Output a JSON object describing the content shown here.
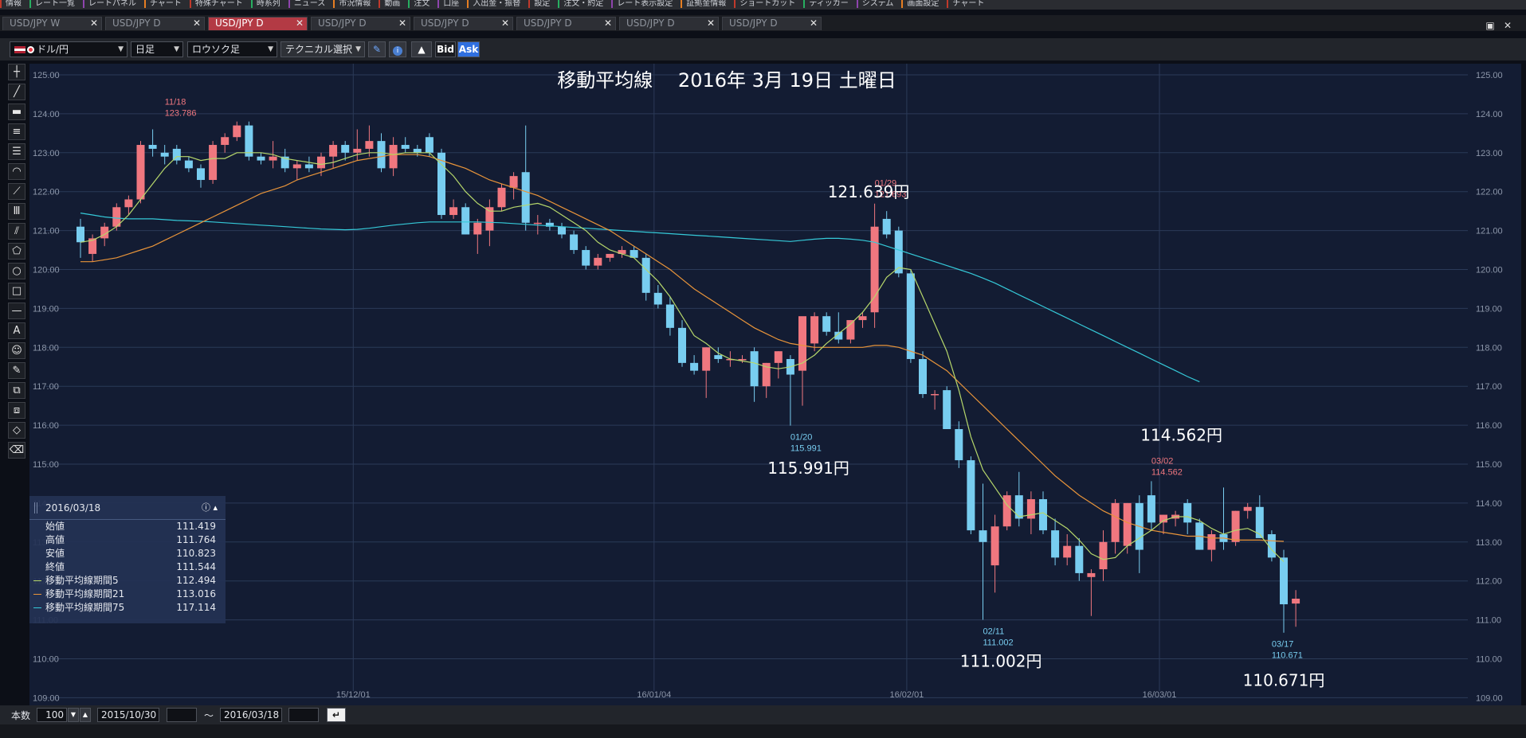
{
  "menubar": [
    "情報",
    "レート一覧",
    "レートパネル",
    "チャート",
    "特殊チャート",
    "時系列",
    "ニュース",
    "市況情報",
    "動画",
    "注文",
    "口座",
    "入出金・振替",
    "設定",
    "注文・約定",
    "レート表示設定",
    "証拠金情報",
    "ショートカット",
    "ティッカー",
    "システム",
    "画面設定",
    "チャート"
  ],
  "tabs": [
    {
      "label": "USD/JPY W",
      "active": false
    },
    {
      "label": "USD/JPY D",
      "active": false
    },
    {
      "label": "USD/JPY D",
      "active": true
    },
    {
      "label": "USD/JPY D",
      "active": false
    },
    {
      "label": "USD/JPY D",
      "active": false
    },
    {
      "label": "USD/JPY D",
      "active": false
    },
    {
      "label": "USD/JPY D",
      "active": false
    },
    {
      "label": "USD/JPY D",
      "active": false
    }
  ],
  "toolbar": {
    "pair": "ドル/円",
    "period": "日足",
    "chart_type": "ロウソク足",
    "technical": "テクニカル選択",
    "bid": "Bid",
    "ask": "Ask"
  },
  "left_tools": [
    "crosshair-icon",
    "line-icon",
    "ruler-icon",
    "horizontal-lines-icon",
    "parallel-lines-icon",
    "arc-icon",
    "fan-icon",
    "grid-lines-icon",
    "trend-channel-icon",
    "pentagon-icon",
    "circle-icon",
    "rectangle-icon",
    "horizontal-line-icon",
    "text-icon",
    "emoji-icon",
    "paint-icon",
    "copy-icon",
    "layer-icon",
    "eraser-icon",
    "clear-icon"
  ],
  "left_tool_text": {
    "text": "A"
  },
  "info": {
    "date": "2016/03/18",
    "rows": [
      {
        "label": "始値",
        "value": "111.419",
        "color": ""
      },
      {
        "label": "高値",
        "value": "111.764",
        "color": ""
      },
      {
        "label": "安値",
        "value": "110.823",
        "color": ""
      },
      {
        "label": "終値",
        "value": "111.544",
        "color": ""
      },
      {
        "label": "移動平均線期間5",
        "value": "112.494",
        "color": "#b6d76b"
      },
      {
        "label": "移動平均線期間21",
        "value": "113.016",
        "color": "#e8943a"
      },
      {
        "label": "移動平均線期間75",
        "value": "117.114",
        "color": "#35c9d8"
      }
    ]
  },
  "bottombar": {
    "count_label": "本数",
    "count": "100",
    "from": "2015/10/30",
    "tilde": "～",
    "to": "2016/03/18"
  },
  "chart_data": {
    "type": "candlestick",
    "title": "移動平均線　 2016年 3月 19日 土曜日",
    "ylim": [
      109,
      125.5
    ],
    "yticks": [
      "125.00",
      "124.00",
      "123.00",
      "122.00",
      "121.00",
      "120.00",
      "119.00",
      "118.00",
      "117.00",
      "116.00",
      "115.00",
      "114.00",
      "113.00",
      "112.00",
      "111.00",
      "110.00",
      "109.00"
    ],
    "xticks": [
      {
        "label": "15/12/01",
        "index": 23
      },
      {
        "label": "16/01/04",
        "index": 48
      },
      {
        "label": "16/02/01",
        "index": 69
      },
      {
        "label": "16/03/01",
        "index": 90
      }
    ],
    "colors": {
      "up": "#f0777f",
      "down": "#78cdf0",
      "ma5": "#b6d76b",
      "ma21": "#e8943a",
      "ma75": "#35c9d8",
      "grid": "#2b3a58",
      "bg": "#131c33"
    },
    "candles": [
      [
        121.1,
        121.3,
        120.3,
        120.7
      ],
      [
        120.4,
        120.9,
        120.2,
        120.8
      ],
      [
        120.8,
        121.2,
        120.6,
        121.1
      ],
      [
        121.1,
        121.7,
        121.0,
        121.6
      ],
      [
        121.6,
        121.9,
        121.4,
        121.8
      ],
      [
        121.8,
        123.3,
        121.7,
        123.2
      ],
      [
        123.2,
        123.6,
        122.9,
        123.1
      ],
      [
        123.0,
        123.2,
        122.7,
        122.9
      ],
      [
        123.1,
        123.2,
        122.7,
        122.8
      ],
      [
        122.8,
        122.9,
        122.5,
        122.6
      ],
      [
        122.6,
        122.7,
        122.1,
        122.3
      ],
      [
        122.3,
        123.3,
        122.2,
        123.2
      ],
      [
        123.2,
        123.5,
        123.0,
        123.4
      ],
      [
        123.4,
        123.8,
        123.3,
        123.7
      ],
      [
        123.7,
        123.8,
        122.8,
        122.9
      ],
      [
        122.9,
        123.0,
        122.7,
        122.8
      ],
      [
        122.8,
        123.3,
        122.6,
        122.9
      ],
      [
        122.9,
        123.1,
        122.5,
        122.6
      ],
      [
        122.6,
        122.8,
        122.3,
        122.7
      ],
      [
        122.7,
        122.9,
        122.5,
        122.6
      ],
      [
        122.6,
        123.0,
        122.4,
        122.9
      ],
      [
        122.9,
        123.3,
        122.6,
        123.2
      ],
      [
        123.2,
        123.3,
        122.8,
        123.0
      ],
      [
        123.0,
        123.6,
        122.8,
        123.1
      ],
      [
        123.1,
        123.7,
        122.9,
        123.3
      ],
      [
        123.3,
        123.5,
        122.5,
        122.6
      ],
      [
        122.6,
        123.4,
        122.4,
        123.2
      ],
      [
        123.2,
        123.4,
        123.0,
        123.1
      ],
      [
        123.1,
        123.2,
        122.9,
        123.0
      ],
      [
        123.4,
        123.5,
        122.9,
        123.0
      ],
      [
        123.0,
        123.1,
        121.3,
        121.4
      ],
      [
        121.4,
        121.8,
        121.3,
        121.6
      ],
      [
        121.6,
        121.7,
        120.9,
        120.9
      ],
      [
        120.9,
        121.3,
        120.4,
        121.2
      ],
      [
        121.0,
        121.8,
        120.6,
        121.6
      ],
      [
        121.6,
        122.2,
        121.5,
        122.1
      ],
      [
        122.1,
        122.5,
        121.8,
        122.4
      ],
      [
        122.5,
        123.7,
        121.0,
        121.2
      ],
      [
        121.2,
        121.4,
        120.9,
        121.2
      ],
      [
        121.2,
        121.3,
        121.0,
        121.1
      ],
      [
        121.1,
        121.2,
        120.8,
        120.9
      ],
      [
        120.9,
        121.0,
        120.4,
        120.5
      ],
      [
        120.5,
        120.6,
        120.0,
        120.1
      ],
      [
        120.1,
        120.4,
        120.0,
        120.3
      ],
      [
        120.3,
        120.4,
        120.2,
        120.4
      ],
      [
        120.4,
        120.6,
        120.3,
        120.5
      ],
      [
        120.5,
        120.6,
        120.3,
        120.3
      ],
      [
        120.3,
        120.4,
        119.2,
        119.4
      ],
      [
        119.4,
        119.6,
        119.0,
        119.1
      ],
      [
        119.1,
        119.3,
        118.3,
        118.5
      ],
      [
        118.5,
        118.7,
        117.5,
        117.6
      ],
      [
        117.6,
        117.8,
        117.3,
        117.4
      ],
      [
        117.4,
        118.0,
        116.7,
        118.0
      ],
      [
        117.8,
        118.0,
        117.6,
        117.7
      ],
      [
        117.7,
        117.9,
        117.5,
        117.7
      ],
      [
        117.7,
        117.8,
        117.6,
        117.7
      ],
      [
        117.9,
        118.0,
        116.6,
        117.0
      ],
      [
        117.0,
        117.6,
        116.7,
        117.6
      ],
      [
        117.6,
        117.9,
        117.2,
        117.9
      ],
      [
        117.7,
        117.8,
        115.99,
        117.3
      ],
      [
        117.4,
        118.1,
        116.5,
        118.8
      ],
      [
        118.1,
        118.9,
        117.9,
        118.8
      ],
      [
        118.8,
        118.9,
        118.3,
        118.4
      ],
      [
        118.4,
        118.9,
        118.1,
        118.2
      ],
      [
        118.2,
        118.7,
        118.1,
        118.7
      ],
      [
        118.7,
        118.9,
        118.5,
        118.8
      ],
      [
        118.9,
        121.693,
        118.5,
        121.1
      ],
      [
        121.3,
        121.5,
        120.8,
        120.9
      ],
      [
        121.0,
        121.1,
        119.8,
        119.9
      ],
      [
        119.9,
        120.0,
        117.6,
        117.7
      ],
      [
        117.7,
        117.9,
        116.7,
        116.8
      ],
      [
        116.8,
        116.9,
        116.4,
        116.8
      ],
      [
        116.9,
        117.0,
        115.9,
        115.9
      ],
      [
        115.9,
        116.1,
        114.9,
        115.1
      ],
      [
        115.1,
        115.2,
        113.2,
        113.3
      ],
      [
        113.3,
        114.5,
        111.002,
        113.0
      ],
      [
        112.4,
        113.7,
        111.7,
        113.4
      ],
      [
        113.4,
        114.3,
        113.3,
        114.2
      ],
      [
        114.2,
        114.8,
        113.4,
        113.6
      ],
      [
        113.6,
        114.3,
        113.2,
        114.1
      ],
      [
        114.1,
        114.3,
        113.2,
        113.3
      ],
      [
        113.3,
        113.6,
        112.4,
        112.6
      ],
      [
        112.6,
        113.2,
        112.4,
        112.9
      ],
      [
        112.9,
        113.1,
        112.0,
        112.2
      ],
      [
        112.1,
        112.3,
        111.1,
        112.2
      ],
      [
        112.3,
        113.3,
        112.0,
        113.0
      ],
      [
        113.0,
        114.1,
        112.7,
        114.0
      ],
      [
        112.9,
        114.0,
        112.7,
        114.0
      ],
      [
        114.0,
        114.2,
        112.2,
        112.8
      ],
      [
        114.2,
        114.562,
        113.3,
        113.5
      ],
      [
        113.5,
        113.7,
        113.2,
        113.7
      ],
      [
        113.6,
        113.8,
        113.4,
        113.7
      ],
      [
        114.0,
        114.1,
        113.2,
        113.5
      ],
      [
        113.5,
        113.6,
        112.8,
        112.8
      ],
      [
        112.8,
        113.3,
        112.5,
        113.2
      ],
      [
        113.2,
        114.4,
        112.8,
        113.0
      ],
      [
        113.0,
        113.8,
        112.9,
        113.8
      ],
      [
        113.8,
        114.0,
        113.6,
        113.9
      ],
      [
        113.9,
        114.2,
        113.1,
        113.1
      ],
      [
        113.2,
        113.3,
        112.5,
        112.6
      ],
      [
        112.6,
        112.8,
        110.671,
        111.4
      ],
      [
        111.419,
        111.764,
        110.823,
        111.544
      ]
    ],
    "ma5": [
      120.7,
      120.75,
      120.9,
      121.1,
      121.4,
      121.8,
      122.2,
      122.6,
      122.9,
      122.9,
      122.8,
      122.85,
      122.85,
      123.0,
      123.0,
      123.0,
      122.95,
      122.85,
      122.8,
      122.75,
      122.7,
      122.75,
      122.85,
      122.95,
      123.0,
      123.0,
      122.95,
      123.0,
      123.0,
      123.0,
      122.7,
      122.4,
      122.0,
      121.7,
      121.5,
      121.5,
      121.6,
      121.65,
      121.7,
      121.6,
      121.4,
      121.2,
      121.0,
      120.7,
      120.5,
      120.4,
      120.3,
      120.0,
      119.7,
      119.3,
      118.8,
      118.3,
      118.1,
      117.85,
      117.7,
      117.65,
      117.6,
      117.5,
      117.45,
      117.5,
      117.6,
      117.8,
      118.1,
      118.35,
      118.6,
      118.9,
      119.3,
      119.8,
      120.05,
      120.0,
      119.3,
      118.6,
      117.9,
      116.9,
      115.7,
      114.85,
      114.4,
      113.95,
      113.65,
      113.7,
      113.75,
      113.55,
      113.35,
      113.05,
      112.7,
      112.55,
      112.6,
      112.9,
      113.1,
      113.3,
      113.55,
      113.65,
      113.65,
      113.55,
      113.35,
      113.2,
      113.3,
      113.35,
      113.2,
      112.8,
      112.494
    ],
    "ma21": [
      120.2,
      120.2,
      120.25,
      120.3,
      120.4,
      120.5,
      120.6,
      120.75,
      120.9,
      121.05,
      121.2,
      121.35,
      121.5,
      121.65,
      121.8,
      121.95,
      122.05,
      122.15,
      122.3,
      122.4,
      122.5,
      122.6,
      122.7,
      122.8,
      122.85,
      122.9,
      122.95,
      122.95,
      122.95,
      122.9,
      122.8,
      122.7,
      122.6,
      122.45,
      122.3,
      122.2,
      122.1,
      122.0,
      121.9,
      121.75,
      121.6,
      121.45,
      121.3,
      121.15,
      121.0,
      120.8,
      120.6,
      120.4,
      120.2,
      120.0,
      119.75,
      119.5,
      119.3,
      119.1,
      118.9,
      118.7,
      118.5,
      118.35,
      118.2,
      118.1,
      118.05,
      118.0,
      118.0,
      118.0,
      118.0,
      118.0,
      118.05,
      118.05,
      118.0,
      117.9,
      117.8,
      117.6,
      117.4,
      117.1,
      116.8,
      116.5,
      116.2,
      115.9,
      115.6,
      115.3,
      115.0,
      114.7,
      114.45,
      114.2,
      114.0,
      113.8,
      113.65,
      113.5,
      113.4,
      113.3,
      113.25,
      113.2,
      113.15,
      113.15,
      113.1,
      113.1,
      113.05,
      113.05,
      113.05,
      113.03,
      113.016
    ],
    "ma75": [
      121.45,
      121.4,
      121.35,
      121.32,
      121.3,
      121.3,
      121.3,
      121.28,
      121.26,
      121.25,
      121.24,
      121.22,
      121.2,
      121.18,
      121.16,
      121.14,
      121.12,
      121.1,
      121.08,
      121.06,
      121.04,
      121.03,
      121.02,
      121.03,
      121.06,
      121.1,
      121.14,
      121.17,
      121.2,
      121.22,
      121.22,
      121.22,
      121.22,
      121.22,
      121.21,
      121.2,
      121.18,
      121.16,
      121.14,
      121.12,
      121.1,
      121.08,
      121.06,
      121.04,
      121.02,
      121.0,
      120.98,
      120.96,
      120.94,
      120.92,
      120.9,
      120.88,
      120.86,
      120.84,
      120.82,
      120.8,
      120.78,
      120.76,
      120.74,
      120.72,
      120.75,
      120.78,
      120.8,
      120.8,
      120.78,
      120.75,
      120.7,
      120.6,
      120.5,
      120.4,
      120.3,
      120.2,
      120.1,
      120.0,
      119.9,
      119.78,
      119.65,
      119.5,
      119.35,
      119.2,
      119.05,
      118.9,
      118.75,
      118.6,
      118.45,
      118.3,
      118.15,
      118.0,
      117.85,
      117.7,
      117.55,
      117.4,
      117.25,
      117.114
    ],
    "ma75_start": 0,
    "annotations": [
      {
        "index": 7,
        "price": 123.786,
        "date": "11/18",
        "value": "123.786",
        "pos": "above",
        "color": "#f0777f"
      },
      {
        "index": 59,
        "price": 115.991,
        "date": "01/20",
        "value": "115.991",
        "pos": "below",
        "color": "#78cdf0"
      },
      {
        "index": 66,
        "price": 121.693,
        "date": "01/29",
        "value": "121.693",
        "pos": "above",
        "color": "#f0777f"
      },
      {
        "index": 75,
        "price": 111.002,
        "date": "02/11",
        "value": "111.002",
        "pos": "below",
        "color": "#78cdf0"
      },
      {
        "index": 89,
        "price": 114.562,
        "date": "03/02",
        "value": "114.562",
        "pos": "above",
        "color": "#f0777f"
      },
      {
        "index": 99,
        "price": 110.671,
        "date": "03/17",
        "value": "110.671",
        "pos": "below",
        "color": "#78cdf0"
      }
    ],
    "big_labels": [
      {
        "text": "121.639円",
        "index": 65.5,
        "price": 121.85
      },
      {
        "text": "115.991円",
        "index": 60.5,
        "price": 114.75
      },
      {
        "text": "114.562円",
        "index": 91.5,
        "price": 115.6
      },
      {
        "text": "111.002円",
        "index": 76.5,
        "price": 109.8
      },
      {
        "text": "110.671円",
        "index": 100,
        "price": 109.3
      }
    ]
  }
}
